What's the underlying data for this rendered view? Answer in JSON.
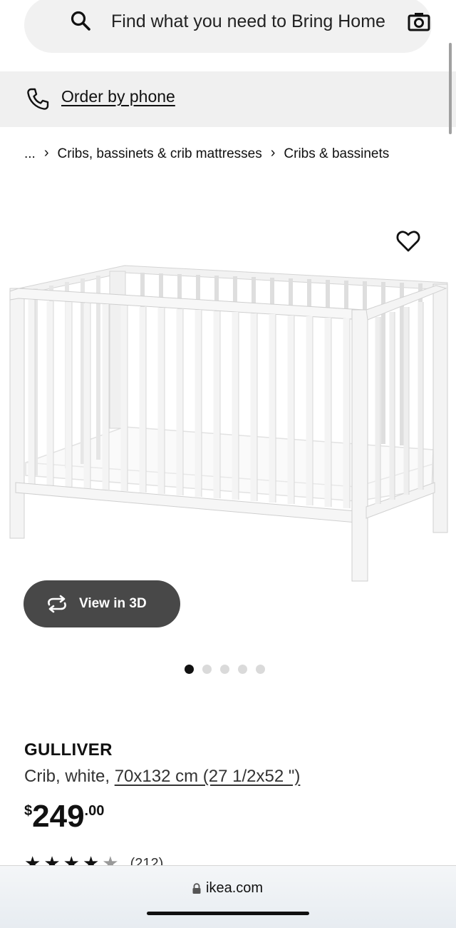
{
  "search": {
    "placeholder": "Find what you need to Bring Home"
  },
  "phone": {
    "label": "Order by phone"
  },
  "breadcrumb": {
    "ellipsis": "...",
    "separator": "›",
    "items": [
      "Cribs, bassinets & crib mattresses",
      "Cribs & bassinets"
    ]
  },
  "gallery": {
    "view_3d_label": "View in 3D",
    "image_count": 5,
    "active_index": 0
  },
  "product": {
    "name": "GULLIVER",
    "desc_prefix": "Crib, white, ",
    "size_link": "70x132 cm (27 1/2x52 \")",
    "price": {
      "currency": "$",
      "integer": "249",
      "decimal": ".00"
    },
    "rating": {
      "stars": 4.5,
      "count_text": "(212)"
    }
  },
  "browser": {
    "url": "ikea.com"
  },
  "icons": {
    "search": "search-icon",
    "camera": "camera-icon",
    "phone": "phone-icon",
    "favorite": "heart-icon",
    "rotate": "rotate-3d-icon",
    "lock": "lock-icon"
  },
  "colors": {
    "view_3d_button": "#484848",
    "active_dot": "#111111",
    "inactive_dot": "#dadada",
    "phone_bar": "#f0f0f0"
  }
}
